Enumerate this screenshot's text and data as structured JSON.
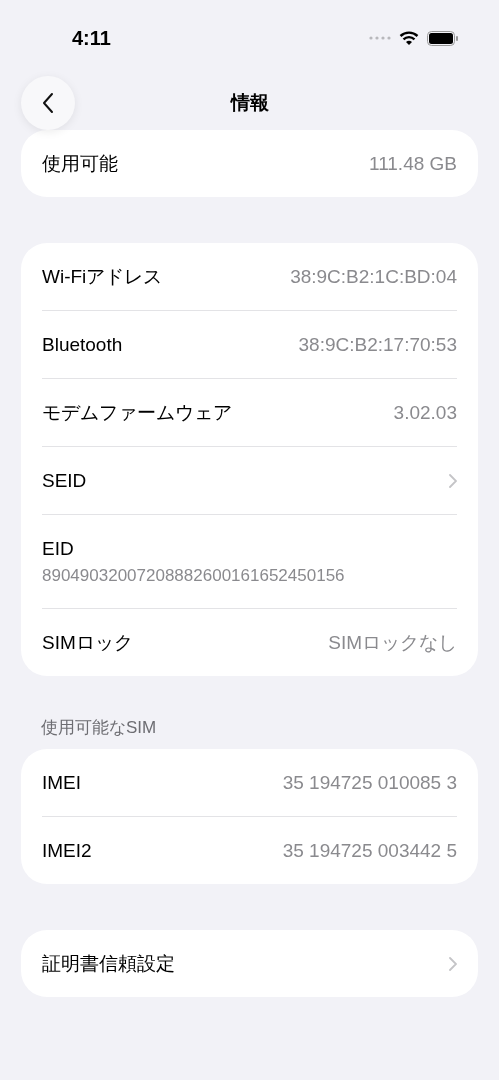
{
  "status_bar": {
    "time": "4:11"
  },
  "nav": {
    "title": "情報"
  },
  "storage": [
    {
      "label": "使用可能",
      "value": "111.48 GB"
    }
  ],
  "network": [
    {
      "kind": "value",
      "label": "Wi-Fiアドレス",
      "value": "38:9C:B2:1C:BD:04"
    },
    {
      "kind": "value",
      "label": "Bluetooth",
      "value": "38:9C:B2:17:70:53"
    },
    {
      "kind": "value",
      "label": "モデムファームウェア",
      "value": "3.02.03"
    },
    {
      "kind": "link",
      "label": "SEID"
    },
    {
      "kind": "stacked",
      "label": "EID",
      "value": "89049032007208882600161652450156"
    },
    {
      "kind": "value",
      "label": "SIMロック",
      "value": "SIMロックなし"
    }
  ],
  "sim_section": {
    "header": "使用可能なSIM",
    "rows": [
      {
        "label": "IMEI",
        "value": "35 194725 010085 3"
      },
      {
        "label": "IMEI2",
        "value": "35 194725 003442 5"
      }
    ]
  },
  "trust": [
    {
      "kind": "link",
      "label": "証明書信頼設定"
    }
  ]
}
